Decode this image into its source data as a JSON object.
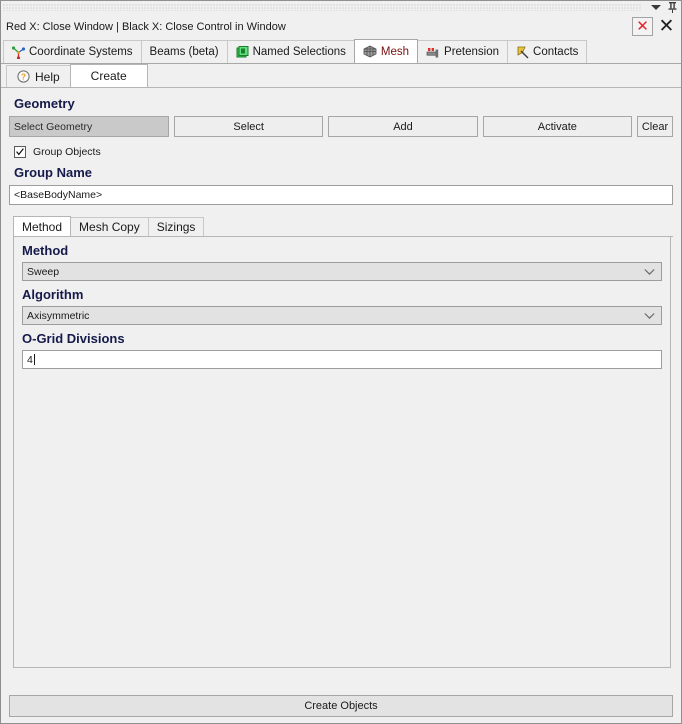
{
  "window": {
    "hint_text": "Red X: Close Window | Black X: Close Control in Window",
    "close_window_label": "✕",
    "close_control_label": "✕",
    "caret_icon": "caret-down-icon",
    "pin_icon": "pin-icon"
  },
  "tabs": [
    {
      "label": "Coordinate Systems",
      "icon": "coordinate-systems-icon",
      "active": false
    },
    {
      "label": "Beams (beta)",
      "icon": "",
      "active": false
    },
    {
      "label": "Named Selections",
      "icon": "named-selections-icon",
      "active": false
    },
    {
      "label": "Mesh",
      "icon": "mesh-icon",
      "active": true
    },
    {
      "label": "Pretension",
      "icon": "pretension-icon",
      "active": false
    },
    {
      "label": "Contacts",
      "icon": "contacts-icon",
      "active": false
    }
  ],
  "subtabs": [
    {
      "label": "Help",
      "icon": "help-icon",
      "active": false
    },
    {
      "label": "Create",
      "icon": "",
      "active": true
    }
  ],
  "geometry": {
    "heading": "Geometry",
    "selected_value": "Select Geometry",
    "buttons": [
      "Select",
      "Add",
      "Activate",
      "Clear"
    ]
  },
  "group": {
    "checkbox_label": "Group Objects",
    "checked": true,
    "name_heading": "Group Name",
    "name_value": "<BaseBodyName>",
    "name_placeholder": "<BaseBodyName>"
  },
  "inner_tabs": [
    {
      "label": "Method",
      "active": true
    },
    {
      "label": "Mesh Copy",
      "active": false
    },
    {
      "label": "Sizings",
      "active": false
    }
  ],
  "method_panel": {
    "method_label": "Method",
    "method_value": "Sweep",
    "algorithm_label": "Algorithm",
    "algorithm_value": "Axisymmetric",
    "ogrid_label": "O-Grid Divisions",
    "ogrid_value": "4"
  },
  "footer": {
    "create_objects_label": "Create Objects"
  },
  "colors": {
    "heading": "#151a4a",
    "active_tab_text": "#7a1010",
    "close_red": "#e8252a",
    "panel_bg": "#f0f0f0"
  }
}
